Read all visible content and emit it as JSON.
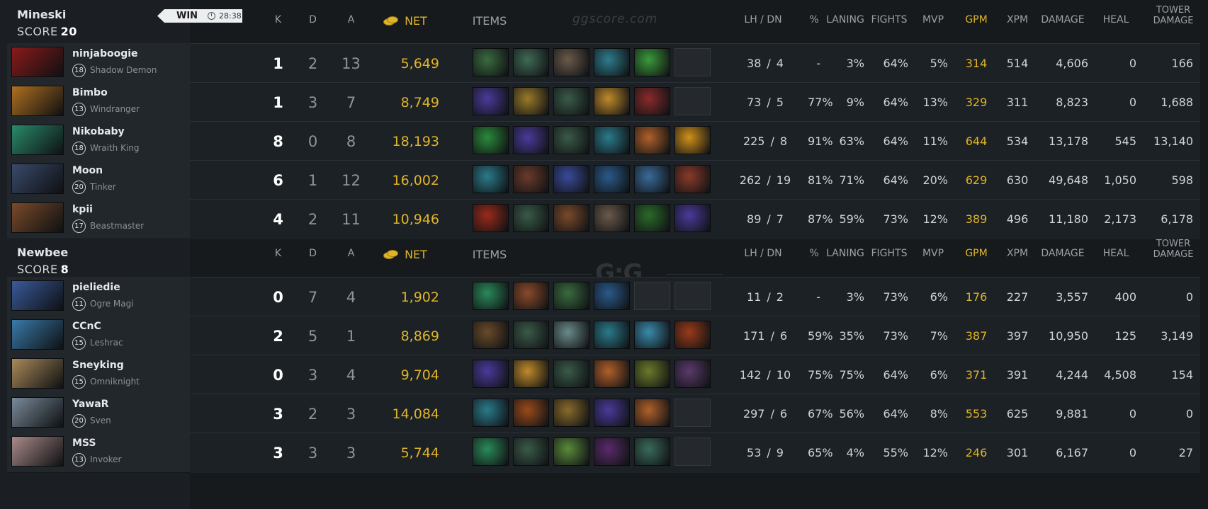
{
  "colors": {
    "gold": "#e0b428",
    "bg": "#161a1d",
    "panel": "#1b1f23",
    "row": "#1c2125"
  },
  "watermark": {
    "site": "ggscore.com",
    "logo": "G:G",
    "logo_sub": "ggscore.com"
  },
  "headers": {
    "k": "K",
    "d": "D",
    "a": "A",
    "net": "NET",
    "items": "ITEMS",
    "lh_dn": "LH  /  DN",
    "pct": "%",
    "laning": "LANING",
    "fights": "FIGHTS",
    "mvp": "MVP",
    "gpm": "GPM",
    "xpm": "XPM",
    "damage": "DAMAGE",
    "heal": "HEAL",
    "tower_line1": "TOWER",
    "tower_line2": "DAMAGE"
  },
  "teams": [
    {
      "name": "Mineski",
      "score_label": "SCORE",
      "score": "20",
      "result": "WIN",
      "time": "28:38",
      "players": [
        {
          "name": "ninjaboogie",
          "level": "18",
          "hero": "Shadow Demon",
          "portrait_color": "#8a1a1a",
          "k": "1",
          "d": "2",
          "a": "13",
          "net": "5,649",
          "items": [
            "#3a6b3f",
            "#3f6a55",
            "#6a5a4a",
            "#2d7c8c",
            "#3a9a3a",
            "empty"
          ],
          "lh": "38",
          "dn": "4",
          "pct": "-",
          "laning": "3%",
          "fights": "64%",
          "mvp": "5%",
          "gpm": "314",
          "xpm": "514",
          "damage": "4,606",
          "heal": "0",
          "tower": "166"
        },
        {
          "name": "Bimbo",
          "level": "13",
          "hero": "Windranger",
          "portrait_color": "#b07020",
          "k": "1",
          "d": "3",
          "a": "7",
          "net": "8,749",
          "items": [
            "#4a3a9a",
            "#9a7a2a",
            "#3a5a48",
            "#c08a2a",
            "#8a2a2a",
            "empty"
          ],
          "lh": "73",
          "dn": "5",
          "pct": "77%",
          "laning": "9%",
          "fights": "64%",
          "mvp": "13%",
          "gpm": "329",
          "xpm": "311",
          "damage": "8,823",
          "heal": "0",
          "tower": "1,688"
        },
        {
          "name": "Nikobaby",
          "level": "18",
          "hero": "Wraith King",
          "portrait_color": "#2a8a6a",
          "k": "8",
          "d": "0",
          "a": "8",
          "net": "18,193",
          "items": [
            "#2a8a3a",
            "#4a3a9a",
            "#3a5a48",
            "#2a7a8a",
            "#b0602a",
            "#d0901a"
          ],
          "lh": "225",
          "dn": "8",
          "pct": "91%",
          "laning": "63%",
          "fights": "64%",
          "mvp": "11%",
          "gpm": "644",
          "xpm": "534",
          "damage": "13,178",
          "heal": "545",
          "tower": "13,140"
        },
        {
          "name": "Moon",
          "level": "20",
          "hero": "Tinker",
          "portrait_color": "#3a4a6a",
          "k": "6",
          "d": "1",
          "a": "12",
          "net": "16,002",
          "items": [
            "#2a7a8a",
            "#6a3a2a",
            "#3a4a9a",
            "#2a5a8a",
            "#3a6a9a",
            "#8a3a2a"
          ],
          "lh": "262",
          "dn": "19",
          "pct": "81%",
          "laning": "71%",
          "fights": "64%",
          "mvp": "20%",
          "gpm": "629",
          "xpm": "630",
          "damage": "49,648",
          "heal": "1,050",
          "tower": "598"
        },
        {
          "name": "kpii",
          "level": "17",
          "hero": "Beastmaster",
          "portrait_color": "#7a4a2a",
          "k": "4",
          "d": "2",
          "a": "11",
          "net": "10,946",
          "items": [
            "#9a2a1a",
            "#3a5a48",
            "#7a4a2a",
            "#6a5a4a",
            "#2a6a2a",
            "#4a3a9a"
          ],
          "lh": "89",
          "dn": "7",
          "pct": "87%",
          "laning": "59%",
          "fights": "73%",
          "mvp": "12%",
          "gpm": "389",
          "xpm": "496",
          "damage": "11,180",
          "heal": "2,173",
          "tower": "6,178"
        }
      ]
    },
    {
      "name": "Newbee",
      "score_label": "SCORE",
      "score": "8",
      "players": [
        {
          "name": "pieliedie",
          "level": "11",
          "hero": "Ogre Magi",
          "portrait_color": "#3a5a9a",
          "k": "0",
          "d": "7",
          "a": "4",
          "net": "1,902",
          "items": [
            "#2a8a5a",
            "#8a4a2a",
            "#3a6b3f",
            "#2a5a8a",
            "empty",
            "empty"
          ],
          "lh": "11",
          "dn": "2",
          "pct": "-",
          "laning": "3%",
          "fights": "73%",
          "mvp": "6%",
          "gpm": "176",
          "xpm": "227",
          "damage": "3,557",
          "heal": "400",
          "tower": "0"
        },
        {
          "name": "CCnC",
          "level": "15",
          "hero": "Leshrac",
          "portrait_color": "#3a7aaa",
          "k": "2",
          "d": "5",
          "a": "1",
          "net": "8,869",
          "items": [
            "#6a4a2a",
            "#3a5a48",
            "#6a8a8a",
            "#2a7a8a",
            "#3a8aaa",
            "#9a3a1a"
          ],
          "lh": "171",
          "dn": "6",
          "pct": "59%",
          "laning": "35%",
          "fights": "73%",
          "mvp": "7%",
          "gpm": "387",
          "xpm": "397",
          "damage": "10,950",
          "heal": "125",
          "tower": "3,149"
        },
        {
          "name": "Sneyking",
          "level": "15",
          "hero": "Omniknight",
          "portrait_color": "#aa8a5a",
          "k": "0",
          "d": "3",
          "a": "4",
          "net": "9,704",
          "items": [
            "#4a3a9a",
            "#c08a2a",
            "#3a5a48",
            "#b0602a",
            "#6a7a2a",
            "#5a3a6a"
          ],
          "lh": "142",
          "dn": "10",
          "pct": "75%",
          "laning": "75%",
          "fights": "64%",
          "mvp": "6%",
          "gpm": "371",
          "xpm": "391",
          "damage": "4,244",
          "heal": "4,508",
          "tower": "154"
        },
        {
          "name": "YawaR",
          "level": "20",
          "hero": "Sven",
          "portrait_color": "#7a8a9a",
          "k": "3",
          "d": "2",
          "a": "3",
          "net": "14,084",
          "items": [
            "#2a7a8a",
            "#9a4a1a",
            "#8a6a2a",
            "#4a3a9a",
            "#b0602a",
            "empty"
          ],
          "lh": "297",
          "dn": "6",
          "pct": "67%",
          "laning": "56%",
          "fights": "64%",
          "mvp": "8%",
          "gpm": "553",
          "xpm": "625",
          "damage": "9,881",
          "heal": "0",
          "tower": "0"
        },
        {
          "name": "MSS",
          "level": "13",
          "hero": "Invoker",
          "portrait_color": "#aa8a8a",
          "k": "3",
          "d": "3",
          "a": "3",
          "net": "5,744",
          "items": [
            "#2a8a5a",
            "#3a5a48",
            "#5a8a3a",
            "#5a2a6a",
            "#3a6a5a",
            "empty"
          ],
          "lh": "53",
          "dn": "9",
          "pct": "65%",
          "laning": "4%",
          "fights": "55%",
          "mvp": "12%",
          "gpm": "246",
          "xpm": "301",
          "damage": "6,167",
          "heal": "0",
          "tower": "27"
        }
      ]
    }
  ]
}
